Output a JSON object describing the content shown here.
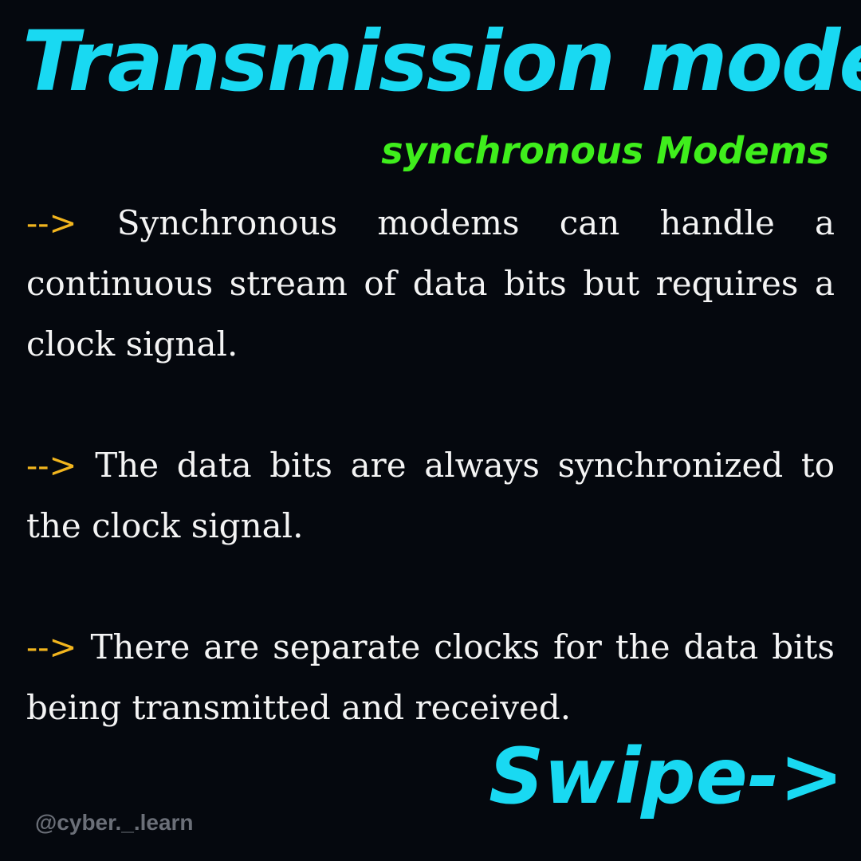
{
  "header": {
    "title": "Transmission mode",
    "subtitle": "synchronous Modems"
  },
  "points": [
    {
      "marker": "-->",
      "text": "Synchronous modems can handle a continuous stream of data bits but requires a clock signal."
    },
    {
      "marker": "-->",
      "text": "The data bits are always synchronized to the clock signal."
    },
    {
      "marker": "-->",
      "text": "There are separate clocks for the data bits being transmitted and received."
    }
  ],
  "footer": {
    "swipe_label": "Swipe->",
    "handle": "@cyber._.learn"
  },
  "colors": {
    "background": "#05080e",
    "title": "#19d9f2",
    "subtitle": "#3fee1c",
    "marker": "#f2b51e",
    "body_text": "#f4f4f4",
    "handle": "#6b6f78"
  }
}
